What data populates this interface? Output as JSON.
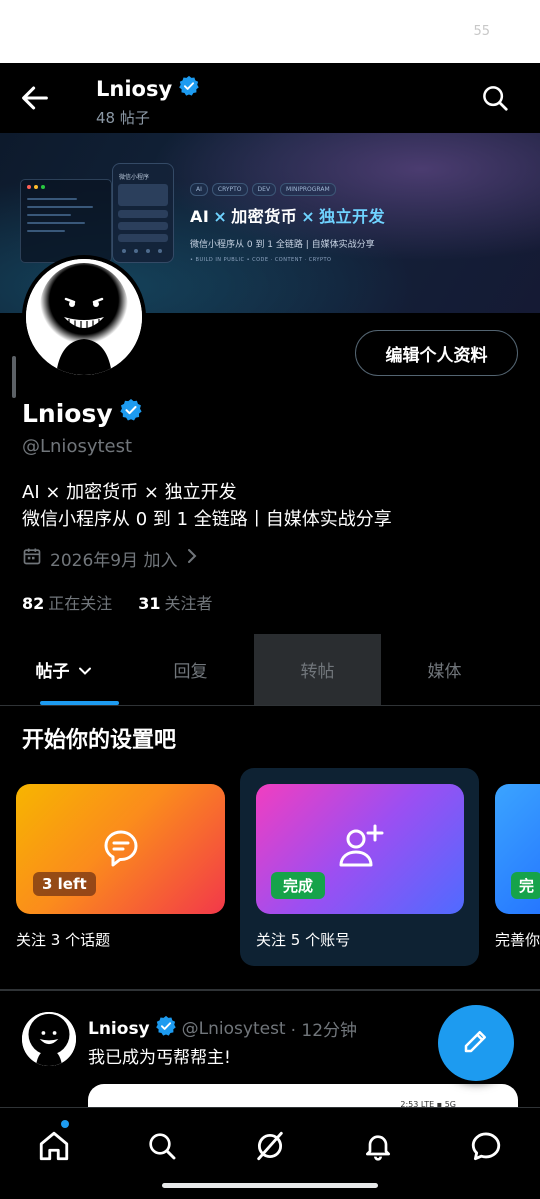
{
  "status_bar": {
    "number": "55"
  },
  "header": {
    "name": "Lniosy",
    "post_count": "48 帖子"
  },
  "banner": {
    "tags": [
      "AI",
      "CRYPTO",
      "DEV",
      "MINIPROGRAM"
    ],
    "title_a": "AI",
    "title_x": "×",
    "title_b": "加密货币",
    "title_c": "独立开发",
    "subtitle": "微信小程序从 0 到 1 全链路 | 自媒体实战分享",
    "footer": "• BUILD IN PUBLIC • CODE · CONTENT · CRYPTO",
    "phone_title": "微信小程序"
  },
  "profile": {
    "edit_button": "编辑个人资料",
    "name": "Lniosy",
    "handle": "@Lniosytest",
    "bio_line1": "AI × 加密货币 × 独立开发",
    "bio_line2": "微信小程序从 0 到 1 全链路丨自媒体实战分享",
    "joined": "2026年9月 加入",
    "following_count": "82",
    "following_label": "正在关注",
    "followers_count": "31",
    "followers_label": "关注者"
  },
  "tabs": [
    {
      "label": "帖子"
    },
    {
      "label": "回复"
    },
    {
      "label": "转帖"
    },
    {
      "label": "媒体"
    }
  ],
  "setup": {
    "title": "开始你的设置吧",
    "cards": [
      {
        "badge": "3 left",
        "label": "关注 3 个话题"
      },
      {
        "badge": "完成",
        "label": "关注 5 个账号"
      },
      {
        "badge": "完",
        "label": "完善你"
      }
    ]
  },
  "post": {
    "name": "Lniosy",
    "handle": "@Lniosytest",
    "time": "· 12分钟",
    "text": "我已成为丐帮帮主!",
    "media_status": "2:53 LTE ▪ 5G"
  },
  "colors": {
    "accent": "#1d9bf0",
    "background": "#000000",
    "muted": "#71767b",
    "done_green": "#16a34a"
  },
  "icons": [
    "back-arrow-icon",
    "verified-icon",
    "search-icon",
    "calendar-icon",
    "chevron-right-icon",
    "chevron-down-icon",
    "chat-bubble-icon",
    "add-user-icon",
    "compose-icon",
    "home-icon",
    "grok-icon",
    "bell-icon",
    "messages-icon"
  ]
}
